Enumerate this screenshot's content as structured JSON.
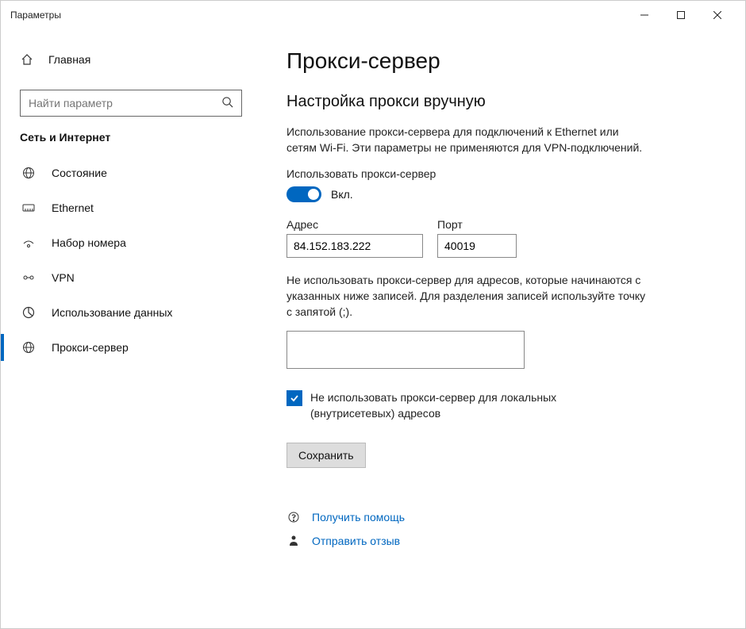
{
  "window": {
    "title": "Параметры"
  },
  "sidebar": {
    "home": "Главная",
    "search": {
      "placeholder": "Найти параметр"
    },
    "category": "Сеть и Интернет",
    "items": [
      {
        "label": "Состояние"
      },
      {
        "label": "Ethernet"
      },
      {
        "label": "Набор номера"
      },
      {
        "label": "VPN"
      },
      {
        "label": "Использование данных"
      },
      {
        "label": "Прокси-сервер"
      }
    ]
  },
  "main": {
    "title": "Прокси-сервер",
    "section_title": "Настройка прокси вручную",
    "description": "Использование прокси-сервера для подключений к Ethernet или сетям Wi-Fi. Эти параметры не применяются для VPN-подключений.",
    "use_proxy_label": "Использовать прокси-сервер",
    "toggle_state": "Вкл.",
    "address_label": "Адрес",
    "address_value": "84.152.183.222",
    "port_label": "Порт",
    "port_value": "40019",
    "exceptions_label": "Не использовать прокси-сервер для адресов, которые начинаются с указанных ниже записей. Для разделения записей используйте точку с запятой (;).",
    "exceptions_value": "",
    "bypass_local_label": "Не использовать прокси-сервер для локальных (внутрисетевых) адресов",
    "save": "Сохранить",
    "help_link": "Получить помощь",
    "feedback_link": "Отправить отзыв"
  }
}
